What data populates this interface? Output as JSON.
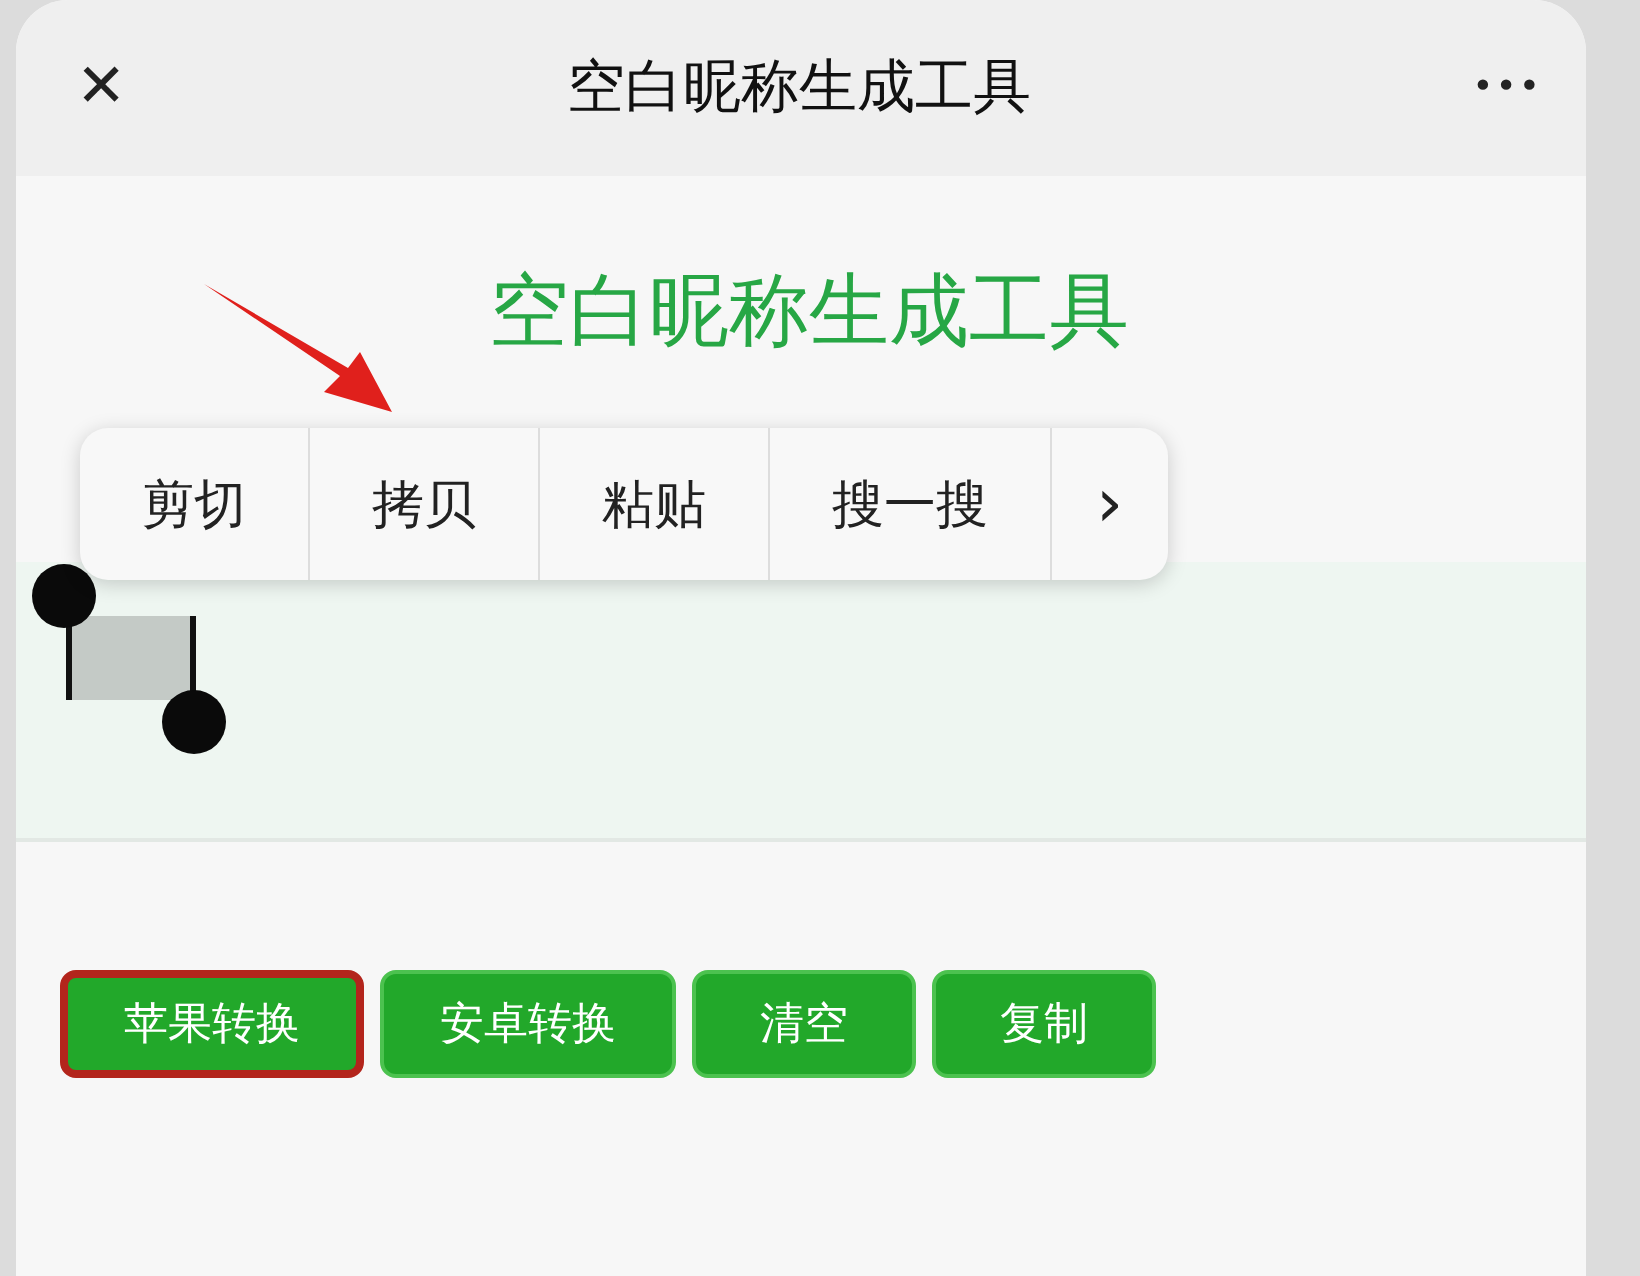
{
  "window": {
    "title": "空白昵称生成工具",
    "close_symbol": "✕",
    "more_symbol": "•••"
  },
  "page": {
    "heading": "空白昵称生成工具"
  },
  "context_menu": {
    "items": [
      {
        "label": "剪切"
      },
      {
        "label": "拷贝"
      },
      {
        "label": "粘贴"
      },
      {
        "label": "搜一搜"
      },
      {
        "label": "›"
      }
    ]
  },
  "buttons": [
    {
      "label": "苹果转换",
      "highlighted": true
    },
    {
      "label": "安卓转换",
      "highlighted": false
    },
    {
      "label": "清空",
      "highlighted": false
    },
    {
      "label": "复制",
      "highlighted": false
    }
  ]
}
